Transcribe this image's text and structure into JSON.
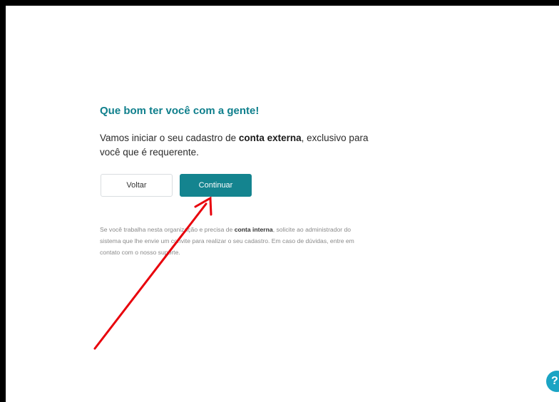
{
  "signup": {
    "title": "Que bom ter você com a gente!",
    "intro_part1": "Vamos iniciar o seu cadastro de ",
    "intro_bold": "conta externa",
    "intro_part2": ", exclusivo para você que é requerente.",
    "back_label": "Voltar",
    "continue_label": "Continuar",
    "note_part1": "Se você trabalha nesta organização e precisa de ",
    "note_bold": "conta interna",
    "note_part2": ", solicite ao administrador do sistema que lhe envie um convite para realizar o seu cadastro. Em caso de dúvidas, entre em contato com o nosso suporte."
  },
  "help": {
    "icon_glyph": "?"
  },
  "colors": {
    "accent": "#14848f",
    "title": "#0f7f8c",
    "annotation_arrow": "#e8000b",
    "help": "#1aa4c4"
  }
}
